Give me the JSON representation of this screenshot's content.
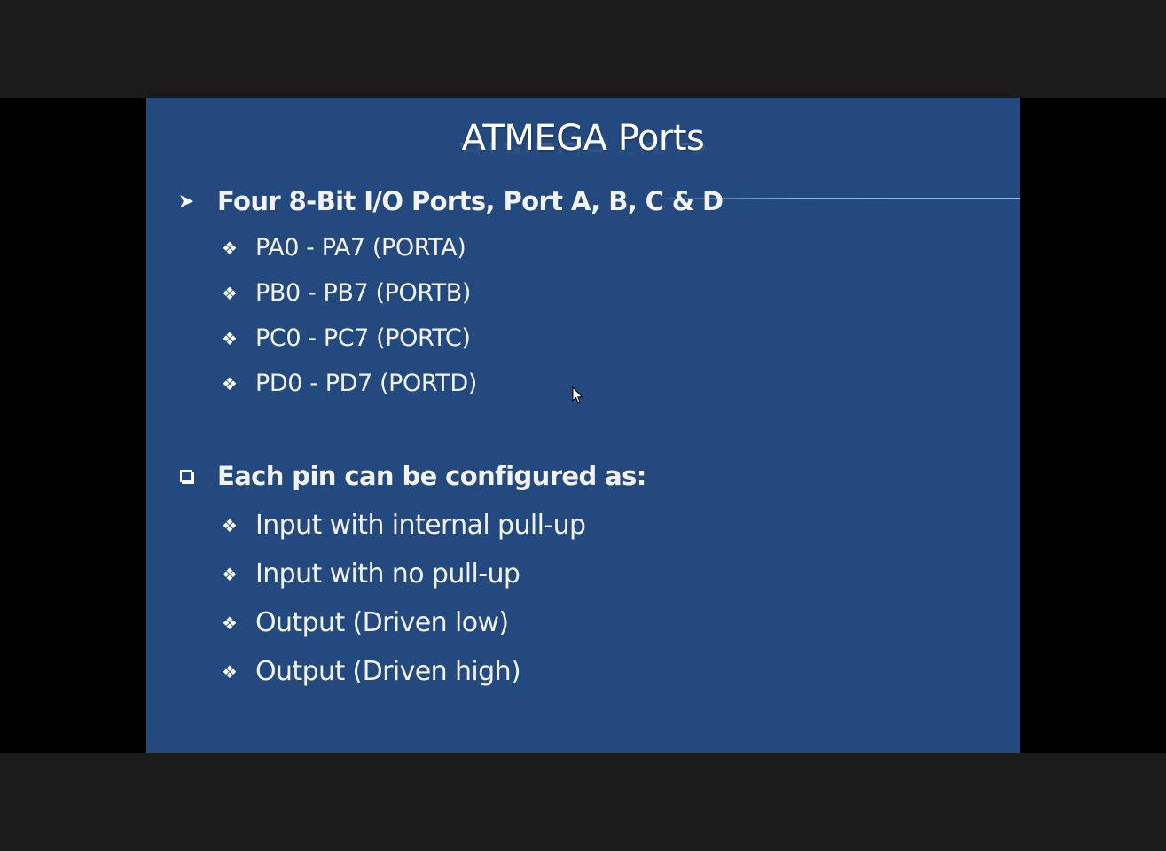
{
  "slide": {
    "title": "ATMEGA Ports",
    "section1": {
      "bullet_icon": "arrow-bullet-icon",
      "heading": "Four 8-Bit I/O Ports, Port A, B, C & D",
      "items": [
        "PA0 - PA7 (PORTA)",
        "PB0 - PB7 (PORTB)",
        "PC0 - PC7 (PORTC)",
        "PD0 - PD7 (PORTD)"
      ]
    },
    "section2": {
      "bullet_icon": "checkbox-bullet-icon",
      "heading": "Each pin can be configured as:",
      "items": [
        "Input with internal pull-up",
        "Input with no pull-up",
        "Output (Driven low)",
        "Output (Driven high)"
      ]
    },
    "sub_bullet_icon": "diamond-bullet-icon"
  },
  "colors": {
    "slide_background": "#23497e",
    "frame_background": "#1b1b1b",
    "letterbox": "#000000",
    "text": "#f2f2f2"
  }
}
